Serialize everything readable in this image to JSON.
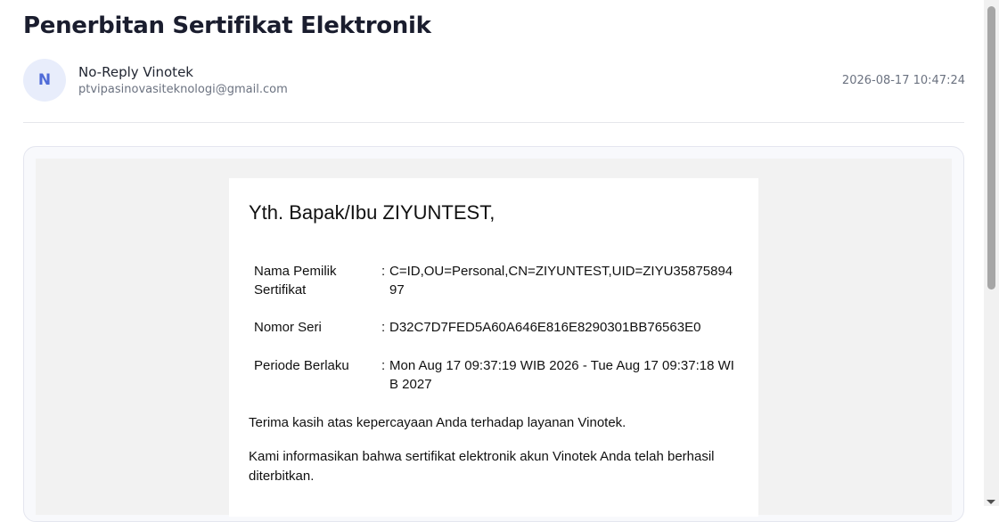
{
  "email": {
    "subject": "Penerbitan Sertifikat Elektronik",
    "sender": {
      "avatar_initial": "N",
      "name": "No-Reply Vinotek",
      "email": "ptvipasinovasiteknologi@gmail.com"
    },
    "timestamp": "2026-08-17 10:47:24"
  },
  "body": {
    "greeting": "Yth. Bapak/Ibu ZIYUNTEST,",
    "colon": ":",
    "fields": [
      {
        "label": "Nama Pemilik Sertifikat",
        "value": "C=ID,OU=Personal,CN=ZIYUNTEST,UID=ZIYU3587589497"
      },
      {
        "label": "Nomor Seri",
        "value": "D32C7D7FED5A60A646E816E8290301BB76563E0"
      },
      {
        "label": "Periode Berlaku",
        "value": "Mon Aug 17 09:37:19 WIB 2026 - Tue Aug 17 09:37:18 WIB 2027"
      }
    ],
    "paragraphs": [
      "Terima kasih atas kepercayaan Anda terhadap layanan Vinotek.",
      "Kami informasikan bahwa sertifikat elektronik akun Vinotek Anda telah berhasil diterbitkan."
    ]
  }
}
